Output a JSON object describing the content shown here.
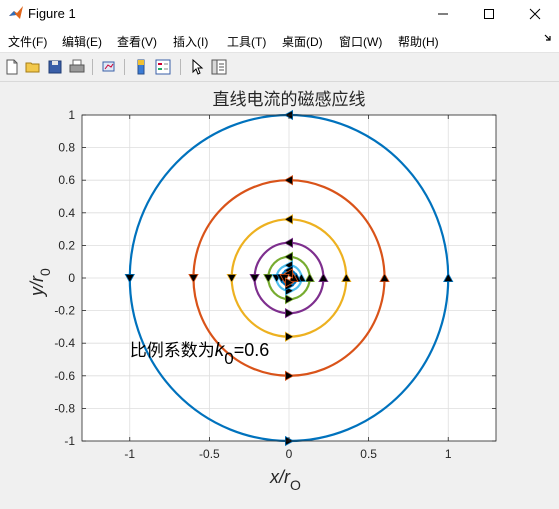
{
  "window": {
    "title": "Figure 1",
    "icon": "matlab-icon",
    "controls": [
      "minimize-icon",
      "maximize-icon",
      "close-icon"
    ]
  },
  "menu": {
    "items": [
      "文件(F)",
      "编辑(E)",
      "查看(V)",
      "插入(I)",
      "工具(T)",
      "桌面(D)",
      "窗口(W)",
      "帮助(H)"
    ],
    "overflow_icon": "menu-arrow-icon"
  },
  "toolbar": {
    "icons": [
      "new-figure-icon",
      "open-file-icon",
      "save-icon",
      "print-icon",
      "link-plot-icon",
      "colorbar-icon",
      "legend-icon",
      "select-arrow-icon",
      "property-editor-icon"
    ]
  },
  "colors": {
    "series1": "#0072BD",
    "series2": "#D95319",
    "series3": "#EDB120",
    "series4": "#7E2F8E",
    "series5": "#77AC30",
    "series6": "#4DBEEE",
    "marker_fill": "#000000",
    "axes_bg": "#ffffff",
    "figure_bg": "#f0f0f0"
  },
  "chart_data": {
    "type": "line",
    "title": "直线电流的磁感应线",
    "xlabel": "x/r",
    "xlabel_sub": "O",
    "ylabel": "y/r",
    "ylabel_sub": "0",
    "xlim": [
      -1.3,
      1.3
    ],
    "ylim": [
      -1,
      1
    ],
    "xticks": [
      -1,
      -0.5,
      0,
      0.5,
      1
    ],
    "xtick_labels": [
      "-1",
      "-0.5",
      "0",
      "0.5",
      "1"
    ],
    "yticks": [
      -1,
      -0.8,
      -0.6,
      -0.4,
      -0.2,
      0,
      0.2,
      0.4,
      0.6,
      0.8,
      1
    ],
    "ytick_labels": [
      "-1",
      "-0.8",
      "-0.6",
      "-0.4",
      "-0.2",
      "0",
      "0.2",
      "0.4",
      "0.6",
      "0.8",
      "1"
    ],
    "grid": true,
    "series": [
      {
        "radius": 1.0,
        "color": "#0072BD"
      },
      {
        "radius": 0.6,
        "color": "#D95319"
      },
      {
        "radius": 0.36,
        "color": "#EDB120"
      },
      {
        "radius": 0.216,
        "color": "#7E2F8E"
      },
      {
        "radius": 0.13,
        "color": "#77AC30"
      },
      {
        "radius": 0.078,
        "color": "#4DBEEE"
      },
      {
        "radius": 0.047,
        "color": "#0072BD"
      },
      {
        "radius": 0.028,
        "color": "#D95319"
      }
    ],
    "annotation": {
      "prefix": "比例系数为",
      "var": "k",
      "sub": "0",
      "value": "=0.6",
      "x": -1.0,
      "y": -0.48
    }
  }
}
